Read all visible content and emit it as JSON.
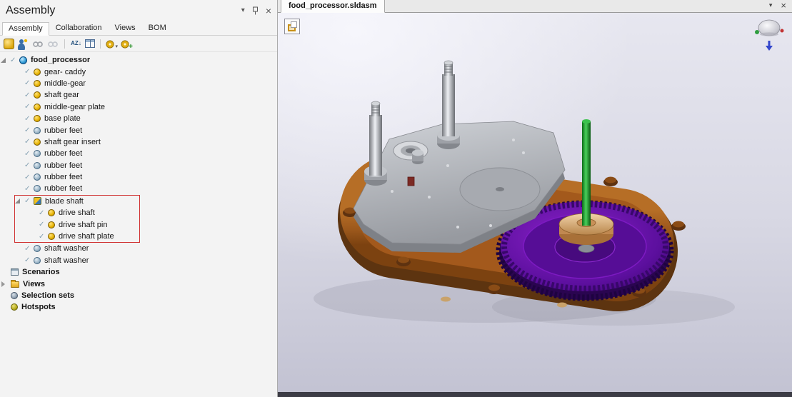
{
  "glyphs": {
    "check": "✓",
    "dropdown": "▾",
    "close": "×"
  },
  "panel": {
    "title": "Assembly",
    "tabs": [
      {
        "label": "Assembly",
        "active": true
      },
      {
        "label": "Collaboration",
        "active": false
      },
      {
        "label": "Views",
        "active": false
      },
      {
        "label": "BOM",
        "active": false
      }
    ]
  },
  "toolbar": {
    "icons": [
      {
        "name": "add-component",
        "type": "gold-square",
        "g": ""
      },
      {
        "name": "collaboration-actor",
        "type": "actor",
        "g": ""
      },
      {
        "name": "link-disabled",
        "type": "rings",
        "g": ""
      },
      {
        "name": "unlink-disabled",
        "type": "rings-light",
        "g": ""
      },
      {
        "name": "separator-1",
        "type": "sep",
        "g": ""
      },
      {
        "name": "sort-alphabetical",
        "type": "sort",
        "g": "AZ↓"
      },
      {
        "name": "column-grid",
        "type": "grid",
        "g": ""
      },
      {
        "name": "separator-2",
        "type": "sep",
        "g": ""
      },
      {
        "name": "visibility-gear",
        "type": "gear-caret",
        "g": "▾"
      },
      {
        "name": "add-gear",
        "type": "gear-plus",
        "g": "+"
      }
    ]
  },
  "tree": {
    "items": [
      {
        "label": "food_processor",
        "level": 0,
        "icon": "assembly-root",
        "bold": true,
        "checked": true,
        "expander": true,
        "expanded": true
      },
      {
        "label": "gear- caddy",
        "level": 1,
        "icon": "part",
        "checked": true
      },
      {
        "label": "middle-gear",
        "level": 1,
        "icon": "part",
        "checked": true
      },
      {
        "label": "shaft gear",
        "level": 1,
        "icon": "part",
        "checked": true
      },
      {
        "label": "middle-gear plate",
        "level": 1,
        "icon": "part",
        "checked": true
      },
      {
        "label": "base plate",
        "level": 1,
        "icon": "part",
        "checked": true
      },
      {
        "label": "rubber feet",
        "level": 1,
        "icon": "fastener",
        "checked": true
      },
      {
        "label": "shaft gear insert",
        "level": 1,
        "icon": "part",
        "checked": true
      },
      {
        "label": "rubber feet",
        "level": 1,
        "icon": "fastener",
        "checked": true
      },
      {
        "label": "rubber feet",
        "level": 1,
        "icon": "fastener",
        "checked": true
      },
      {
        "label": "rubber feet",
        "level": 1,
        "icon": "fastener",
        "checked": true
      },
      {
        "label": "rubber feet",
        "level": 1,
        "icon": "fastener",
        "checked": true
      },
      {
        "label": "blade shaft",
        "level": 1,
        "icon": "subassembly",
        "checked": true,
        "expander": true,
        "expanded": true,
        "highlight": true
      },
      {
        "label": "drive shaft",
        "level": 2,
        "icon": "part",
        "checked": true,
        "highlight": true
      },
      {
        "label": "drive shaft pin",
        "level": 2,
        "icon": "part",
        "checked": true,
        "highlight": true
      },
      {
        "label": "drive shaft plate",
        "level": 2,
        "icon": "part",
        "checked": true,
        "highlight": true
      },
      {
        "label": "shaft washer",
        "level": 1,
        "icon": "fastener",
        "checked": true
      },
      {
        "label": "shaft washer",
        "level": 1,
        "icon": "fastener",
        "checked": true
      },
      {
        "label": "Scenarios",
        "level": 0,
        "icon": "scenarios",
        "bold": true
      },
      {
        "label": "Views",
        "level": 0,
        "icon": "folder",
        "bold": true,
        "expander": true,
        "expanded": false
      },
      {
        "label": "Selection sets",
        "level": 0,
        "icon": "selection-sets",
        "bold": true
      },
      {
        "label": "Hotspots",
        "level": 0,
        "icon": "hotspots",
        "bold": true
      }
    ]
  },
  "viewport": {
    "tab": "food_processor.sldasm",
    "model": "food processor assembly 3D view",
    "colors": {
      "base_plate": "#9a571c",
      "main_gear": "#5c0f9e",
      "drive_shaft": "#2ab13c",
      "gear_plate": "#b4b7bd",
      "pulley": "#d9a873",
      "background_top": "#e7e7f0",
      "background_bottom": "#c2c2d2"
    }
  }
}
